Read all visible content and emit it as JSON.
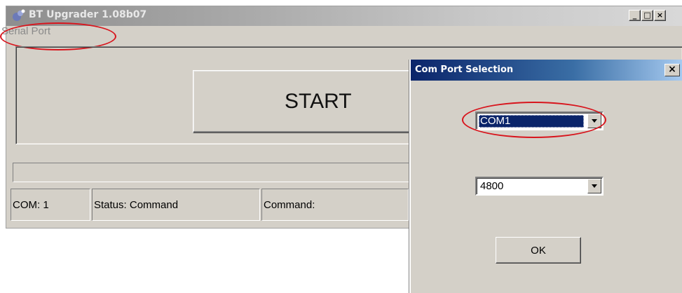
{
  "main_window": {
    "title": "BT Upgrader 1.08b07",
    "controls": {
      "minimize": "_",
      "maximize": "□",
      "close": "×"
    },
    "menu": {
      "serial_port": "Serial Port"
    },
    "start_button": "START",
    "status_bar": {
      "com": "COM: 1",
      "status": "Status: Command",
      "command": "Command:"
    },
    "icon": "app-icon"
  },
  "dialog": {
    "title": "Com Port Selection",
    "close": "×",
    "port_select": {
      "value": "COM1",
      "selected": true
    },
    "baud_select": {
      "value": "4800"
    },
    "ok_button": "OK"
  },
  "colors": {
    "annotation_ellipse": "#d8151d",
    "dialog_title_bar": "#0a246a",
    "window_face": "#d4d0c8"
  }
}
